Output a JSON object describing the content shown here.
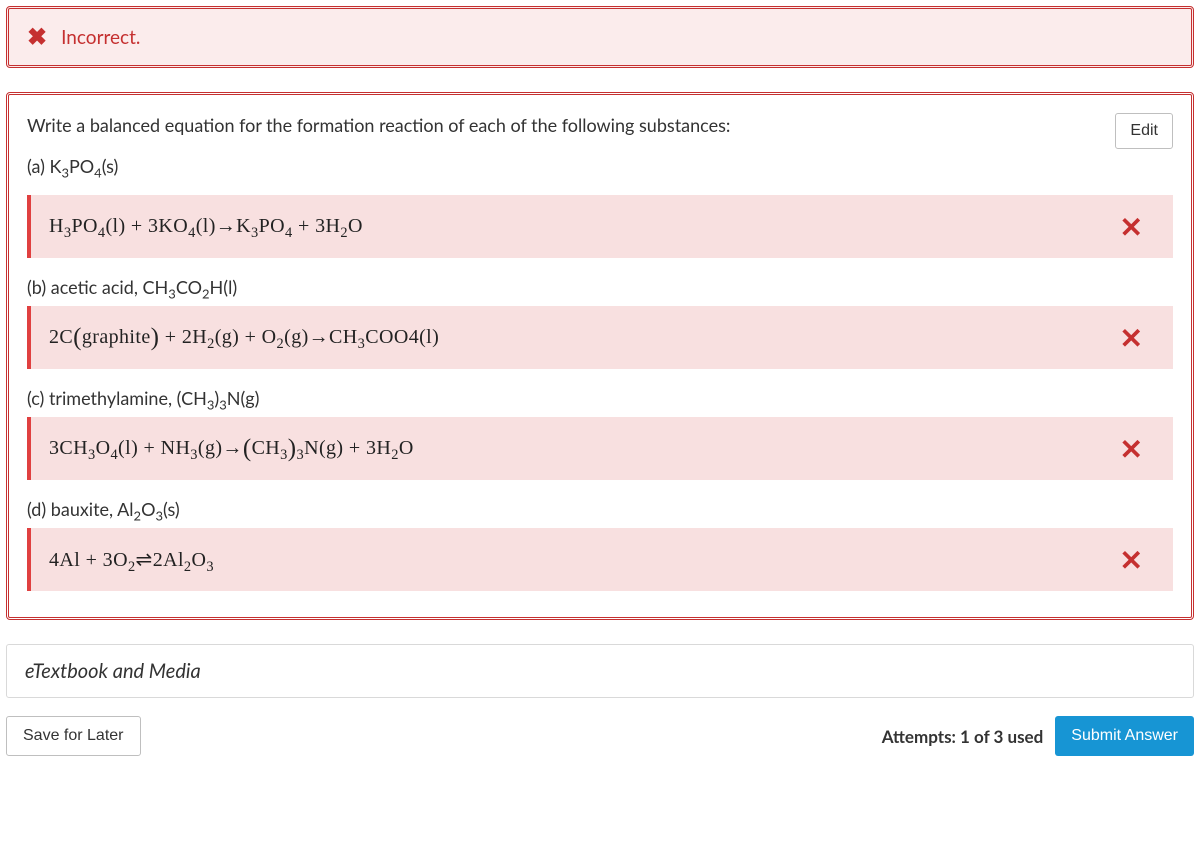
{
  "alert": {
    "icon": "✖",
    "message": "Incorrect."
  },
  "question": {
    "prompt": "Write a balanced equation for the formation reaction of each of the following substances:",
    "edit_label": "Edit",
    "parts": [
      {
        "label": "(a) K",
        "sub1": "3",
        "mid": "PO",
        "sub2": "4",
        "tail": "(s)"
      },
      {
        "label": "(b) acetic acid, CH",
        "sub1": "3",
        "mid": "CO",
        "sub2": "2",
        "tail": "H(l)"
      },
      {
        "label": "(c) trimethylamine, (CH",
        "sub1": "3",
        "mid": ")",
        "sub2": "3",
        "tail": "N(g)"
      },
      {
        "label": "(d) bauxite, Al",
        "sub1": "2",
        "mid": "O",
        "sub2": "3",
        "tail": "(s)"
      }
    ],
    "answers": {
      "a": "H₃PO₄(l) + 3KO₄(l)→K₃PO₄ + 3H₂O",
      "b": "2C(graphite) + 2H₂(g) + O₂(g)→CH₃COO4(l)",
      "c": "3CH₃O₄(l) + NH₃(g)→(CH₃)₃N(g) + 3H₂O",
      "d": "4Al + 3O₂⇌2Al₂O₃"
    },
    "mark_icon": "✕"
  },
  "etextbook_label": "eTextbook and Media",
  "footer": {
    "save_label": "Save for Later",
    "attempts": "Attempts: 1 of 3 used",
    "submit_label": "Submit Answer"
  }
}
